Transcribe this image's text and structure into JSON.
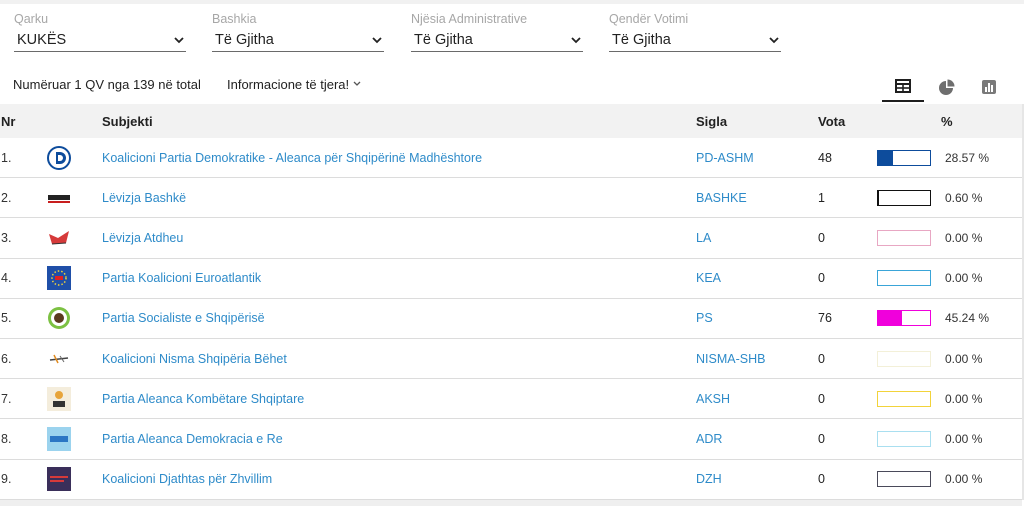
{
  "filters": [
    {
      "label": "Qarku",
      "value": "KUKËS"
    },
    {
      "label": "Bashkia",
      "value": "Të Gjitha"
    },
    {
      "label": "Njësia Administrative",
      "value": "Të Gjitha"
    },
    {
      "label": "Qendër Votimi",
      "value": "Të Gjitha"
    }
  ],
  "info": {
    "counted": "Numëruar 1 QV nga 139 në total",
    "more": "Informacione të tjera!"
  },
  "view_buttons": [
    {
      "icon": "table-icon",
      "active": true
    },
    {
      "icon": "pie-chart-icon",
      "active": false
    },
    {
      "icon": "bar-chart-icon",
      "active": false
    }
  ],
  "table": {
    "headers": {
      "nr": "Nr",
      "subject": "Subjekti",
      "sigla": "Sigla",
      "votes": "Vota",
      "pct": "%"
    },
    "rows": [
      {
        "nr": "1.",
        "name": "Koalicioni Partia Demokratike - Aleanca për Shqipërinë Madhështore",
        "sigla": "PD-ASHM",
        "votes": "48",
        "pct": "28.57 %",
        "fraction": 0.2857,
        "color": "#0d4c9c",
        "logo": "pd-logo"
      },
      {
        "nr": "2.",
        "name": "Lëvizja Bashkë",
        "sigla": "BASHKE",
        "votes": "1",
        "pct": "0.60 %",
        "fraction": 0.006,
        "color": "#111111",
        "logo": "bashke-logo"
      },
      {
        "nr": "3.",
        "name": "Lëvizja Atdheu",
        "sigla": "LA",
        "votes": "0",
        "pct": "0.00 %",
        "fraction": 0,
        "color": "#e8a7c3",
        "logo": "la-logo"
      },
      {
        "nr": "4.",
        "name": "Partia Koalicioni Euroatlantik",
        "sigla": "KEA",
        "votes": "0",
        "pct": "0.00 %",
        "fraction": 0,
        "color": "#3aa5d8",
        "logo": "kea-logo"
      },
      {
        "nr": "5.",
        "name": "Partia Socialiste e Shqipërisë",
        "sigla": "PS",
        "votes": "76",
        "pct": "45.24 %",
        "fraction": 0.4524,
        "color": "#f000dc",
        "logo": "ps-logo"
      },
      {
        "nr": "6.",
        "name": "Koalicioni Nisma Shqipëria Bëhet",
        "sigla": "NISMA-SHB",
        "votes": "0",
        "pct": "0.00 %",
        "fraction": 0,
        "color": "#f3f0d8",
        "logo": "nisma-logo"
      },
      {
        "nr": "7.",
        "name": "Partia Aleanca Kombëtare Shqiptare",
        "sigla": "AKSH",
        "votes": "0",
        "pct": "0.00 %",
        "fraction": 0,
        "color": "#f2d33a",
        "logo": "aksh-logo"
      },
      {
        "nr": "8.",
        "name": "Partia Aleanca Demokracia e Re",
        "sigla": "ADR",
        "votes": "0",
        "pct": "0.00 %",
        "fraction": 0,
        "color": "#a9dff0",
        "logo": "adr-logo"
      },
      {
        "nr": "9.",
        "name": "Koalicioni Djathtas për Zhvillim",
        "sigla": "DZH",
        "votes": "0",
        "pct": "0.00 %",
        "fraction": 0,
        "color": "#4a4a5a",
        "logo": "dzh-logo"
      }
    ]
  }
}
